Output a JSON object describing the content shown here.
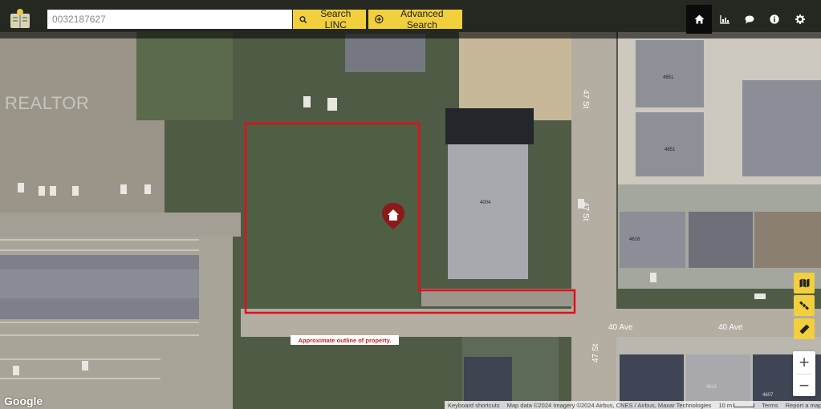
{
  "app": {
    "watermark": "REALTOR"
  },
  "search": {
    "value": "0032187627",
    "button_label": "Search LINC",
    "advanced_label": "Advanced Search"
  },
  "nav": {
    "icons": [
      "home-icon",
      "chart-icon",
      "comment-icon",
      "info-icon",
      "gear-icon"
    ],
    "active": "home"
  },
  "map": {
    "street_labels": {
      "st_top": "47 St",
      "st_mid": "47 St",
      "st_bottom": "47 St",
      "ave_left": "40 Ave",
      "ave_right": "40 Ave"
    },
    "address_labels": {
      "a1": "4651",
      "a2": "4651",
      "a3": "4004",
      "a4": "4616",
      "a5": "4611",
      "a6": "4607"
    },
    "note": "Approximate outline of property.",
    "outline_color": "#e0101a",
    "marker_color": "#8b1a1a"
  },
  "controls": {
    "icons": [
      "map-icon",
      "satellite-icon",
      "ruler-icon"
    ],
    "zoom_in": "+",
    "zoom_out": "−"
  },
  "footer": {
    "google": "Google",
    "keyboard": "Keyboard shortcuts",
    "mapdata": "Map data ©2024 Imagery ©2024 Airbus, CNES / Airbus, Maxar Technologies",
    "scale": "10 m",
    "terms": "Terms",
    "report": "Report a map error"
  }
}
